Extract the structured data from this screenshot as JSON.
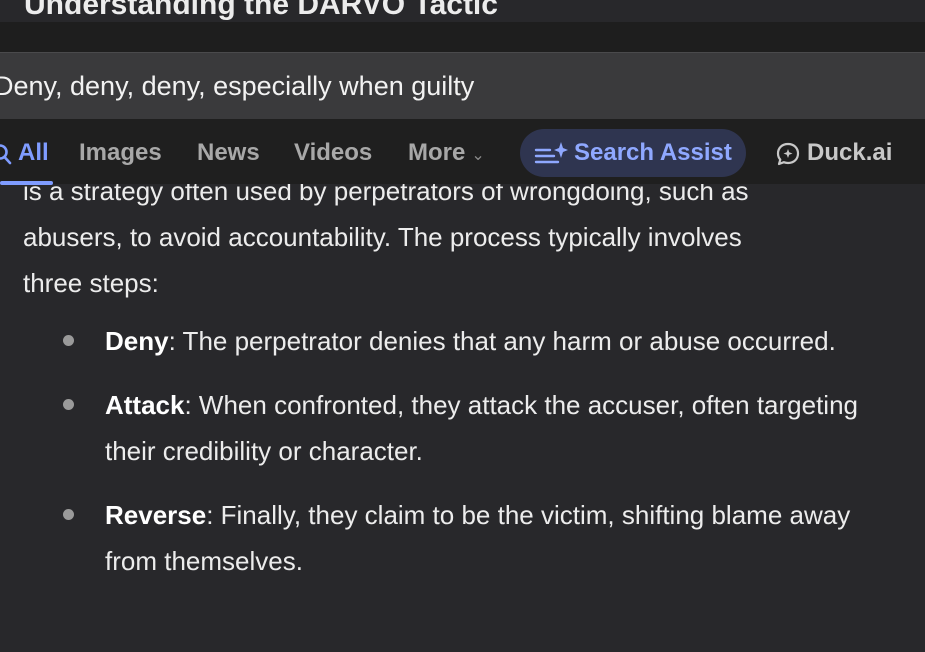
{
  "article": {
    "title": "Understanding the DARVO Tactic",
    "intro_line1": "is a strategy often used by perpetrators of wrongdoing, such as",
    "intro_line2": "abusers, to avoid accountability. The process typically involves",
    "intro_line3": "three steps:",
    "steps": [
      {
        "term": "Deny",
        "text": ": The perpetrator denies that any harm or abuse occurred."
      },
      {
        "term": "Attack",
        "text": ": When confronted, they attack the accuser, often targeting their credibility or character."
      },
      {
        "term": "Reverse",
        "text": ": Finally, they claim to be the victim, shifting blame away from themselves."
      }
    ]
  },
  "search": {
    "query": "Deny, deny, deny, especially when guilty"
  },
  "tabs": {
    "all": "All",
    "images": "Images",
    "news": "News",
    "videos": "Videos",
    "more": "More",
    "search_assist": "Search Assist",
    "duck_ai": "Duck.ai"
  },
  "icons": {
    "search": "search-icon",
    "assist": "sparkle-list-icon",
    "duck_ai": "chat-bubble-icon",
    "more": "chevron-down-icon"
  },
  "colors": {
    "accent": "#7f9cff",
    "background": "#28282b",
    "header": "#1f1f1f",
    "search_bar": "#3a3a3c",
    "assist_pill": "#2f3550"
  }
}
